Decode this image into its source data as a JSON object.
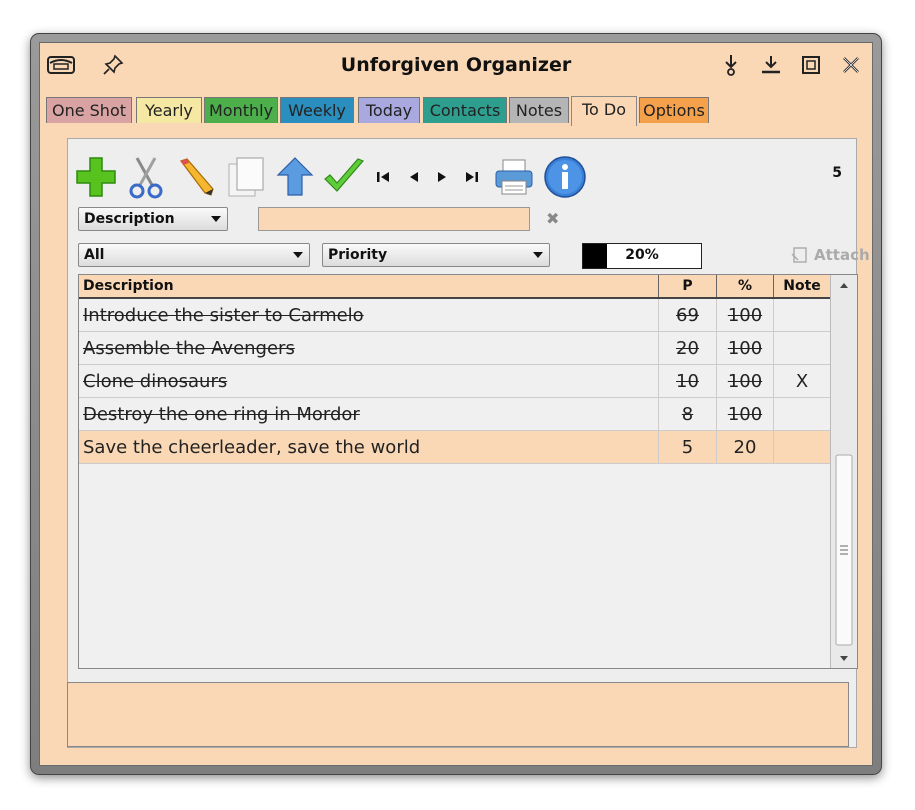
{
  "window": {
    "title": "Unforgiven Organizer"
  },
  "tabs": [
    {
      "label": "One Shot",
      "color": "#d9a3a3"
    },
    {
      "label": "Yearly",
      "color": "#f4e8a2"
    },
    {
      "label": "Monthly",
      "color": "#4caf4c"
    },
    {
      "label": "Weekly",
      "color": "#2a8fbf"
    },
    {
      "label": "Today",
      "color": "#a9a9e0"
    },
    {
      "label": "Contacts",
      "color": "#2e9e8e"
    },
    {
      "label": "Notes",
      "color": "#b5b5b5"
    },
    {
      "label": "To Do",
      "color": "#fad8b6",
      "active": true
    },
    {
      "label": "Options",
      "color": "#f5a04a"
    }
  ],
  "toolbar": {
    "icons": [
      "add-icon",
      "cut-icon",
      "edit-icon",
      "copy-icon",
      "move-up-icon",
      "complete-icon",
      "first-record-icon",
      "prev-record-icon",
      "next-record-icon",
      "last-record-icon",
      "print-icon",
      "info-icon"
    ],
    "count": "5"
  },
  "search": {
    "field": "Description",
    "value": ""
  },
  "filters": {
    "status": "All",
    "sort": "Priority"
  },
  "progress": {
    "value": 0.2,
    "label": "20%"
  },
  "attach_label": "Attach",
  "table": {
    "headers": {
      "description": "Description",
      "priority": "P",
      "percent": "%",
      "note": "Note"
    },
    "rows": [
      {
        "description": "Introduce the sister to Carmelo",
        "priority": "69",
        "percent": "100",
        "note": "",
        "done": true
      },
      {
        "description": "Assemble the Avengers",
        "priority": "20",
        "percent": "100",
        "note": "",
        "done": true
      },
      {
        "description": "Clone dinosaurs",
        "priority": "10",
        "percent": "100",
        "note": "X",
        "done": true
      },
      {
        "description": "Destroy the one ring in Mordor",
        "priority": "8",
        "percent": "100",
        "note": "",
        "done": true
      },
      {
        "description": "Save the cheerleader, save the world",
        "priority": "5",
        "percent": "20",
        "note": "",
        "done": false,
        "selected": true
      }
    ]
  },
  "notes_value": ""
}
